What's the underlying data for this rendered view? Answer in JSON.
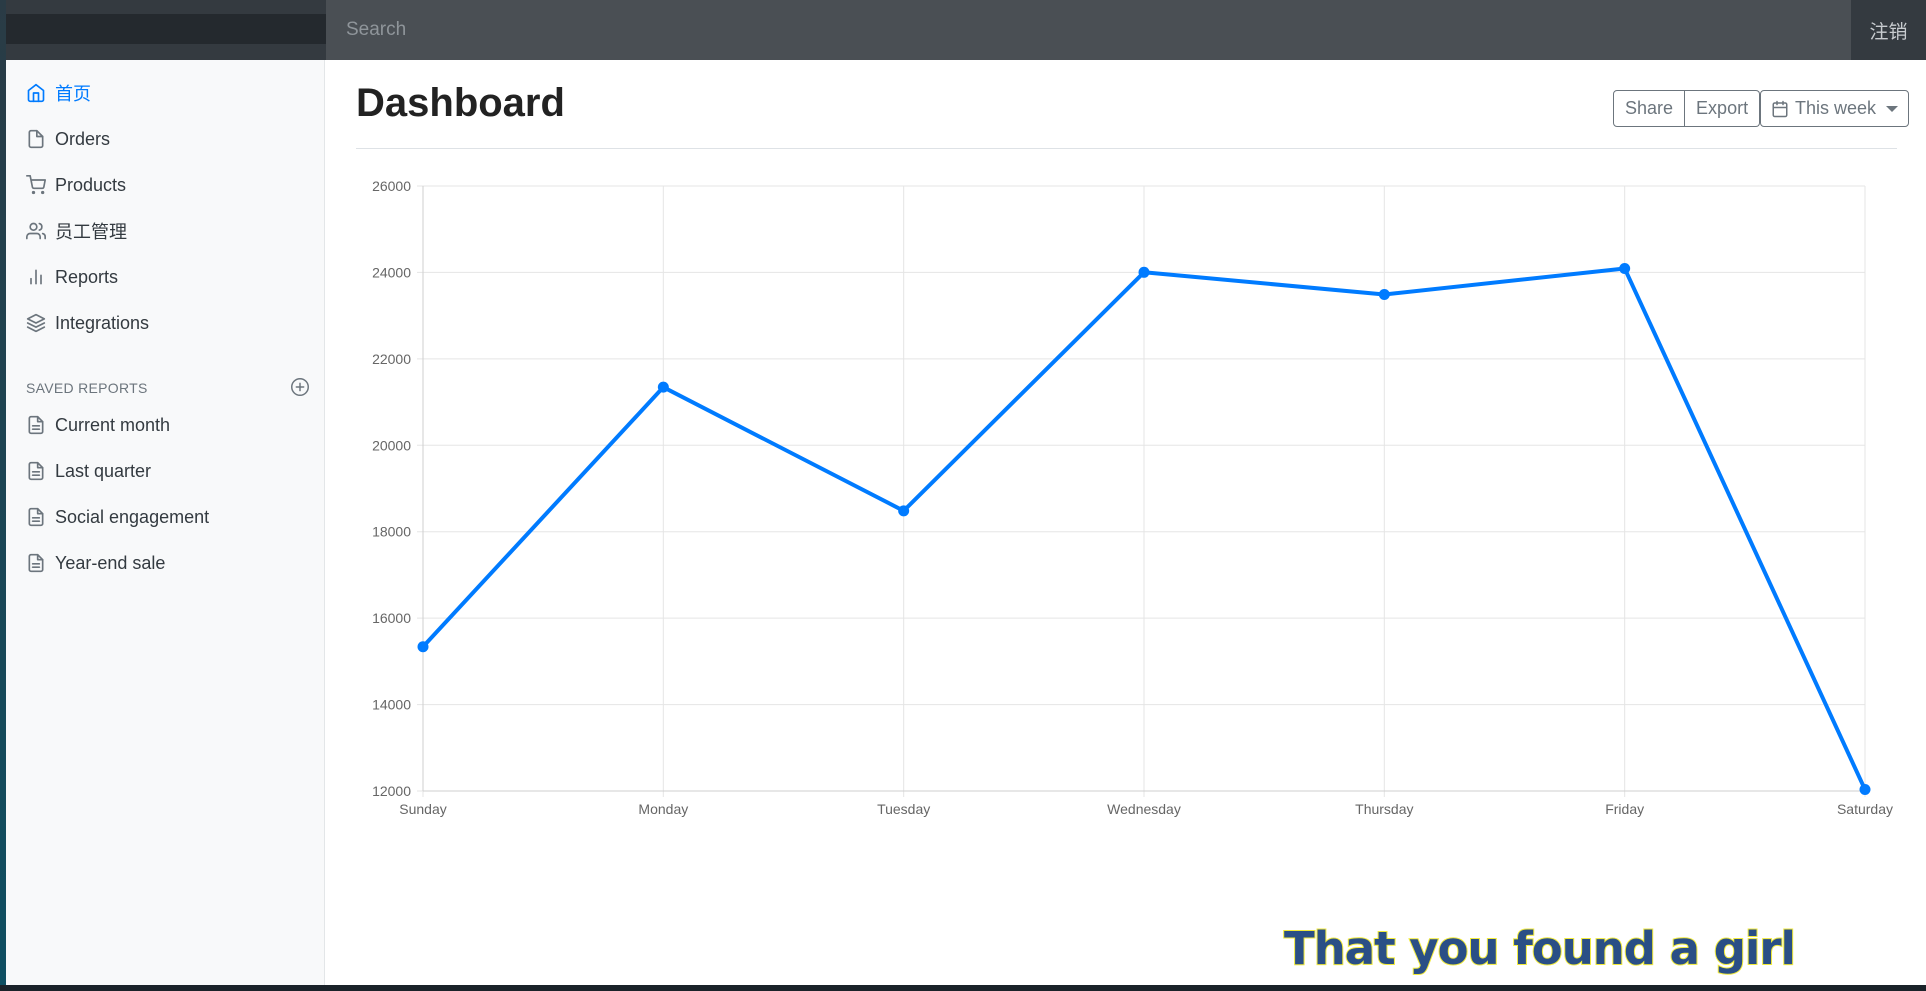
{
  "topbar": {
    "search_placeholder": "Search",
    "signout_label": "注销"
  },
  "sidebar": {
    "items": [
      {
        "label": "首页",
        "icon": "home-icon",
        "active": true
      },
      {
        "label": "Orders",
        "icon": "file-icon"
      },
      {
        "label": "Products",
        "icon": "shopping-cart-icon"
      },
      {
        "label": "员工管理",
        "icon": "users-icon"
      },
      {
        "label": "Reports",
        "icon": "bar-chart-icon"
      },
      {
        "label": "Integrations",
        "icon": "layers-icon"
      }
    ],
    "saved_reports_title": "SAVED REPORTS",
    "saved_reports": [
      {
        "label": "Current month",
        "icon": "file-text-icon"
      },
      {
        "label": "Last quarter",
        "icon": "file-text-icon"
      },
      {
        "label": "Social engagement",
        "icon": "file-text-icon"
      },
      {
        "label": "Year-end sale",
        "icon": "file-text-icon"
      }
    ]
  },
  "main": {
    "title": "Dashboard",
    "share_label": "Share",
    "export_label": "Export",
    "period_label": "This week"
  },
  "chart_data": {
    "type": "line",
    "categories": [
      "Sunday",
      "Monday",
      "Tuesday",
      "Wednesday",
      "Thursday",
      "Friday",
      "Saturday"
    ],
    "series": [
      {
        "values": [
          15339,
          21345,
          18483,
          24003,
          23489,
          24092,
          12034
        ]
      }
    ],
    "ylim": [
      12000,
      26000
    ],
    "yticks": [
      12000,
      14000,
      16000,
      18000,
      20000,
      22000,
      24000,
      26000
    ],
    "grid": true,
    "line_color": "#007bff"
  },
  "overlay_caption": "That you found a girl",
  "colors": {
    "accent": "#007bff",
    "topbar": "#343a40",
    "sidebar": "#f8f9fa"
  }
}
